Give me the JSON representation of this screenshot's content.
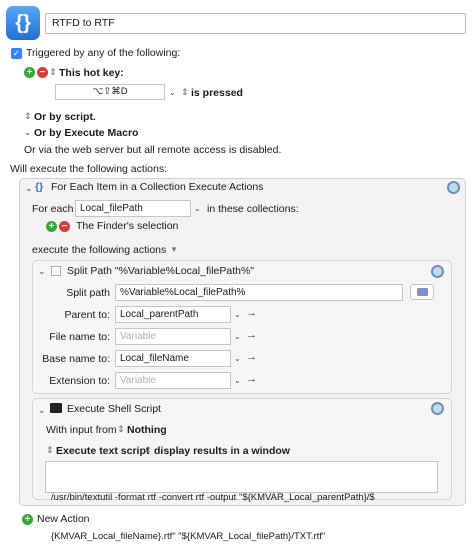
{
  "macro": {
    "icon_glyph": "{}",
    "name": "RTFD to RTF"
  },
  "trigger": {
    "checkbox_label": "Triggered by any of the following:",
    "hotkey_label": "This hot key:",
    "hotkey_value": "⌥⇧⌘D",
    "hotkey_state": "is pressed",
    "or_script": "Or by script.",
    "or_execute_macro": "Or by Execute Macro",
    "web_server_note": "Or via the web server but all remote access is disabled."
  },
  "actions_header": "Will execute the following actions:",
  "for_each": {
    "title": "For Each Item in a Collection Execute Actions",
    "for_each_label": "For each",
    "variable": "Local_filePath",
    "in_collections": "in these collections:",
    "collection_item": "The Finder's selection",
    "execute_label": "execute the following actions"
  },
  "split_path": {
    "title": "Split Path \"%Variable%Local_filePath%\"",
    "split_path_label": "Split path",
    "split_path_value": "%Variable%Local_filePath%",
    "parent_label": "Parent to:",
    "parent_value": "Local_parentPath",
    "file_name_label": "File name to:",
    "file_name_placeholder": "Variable",
    "base_name_label": "Base name to:",
    "base_name_value": "Local_fileName",
    "extension_label": "Extension to:",
    "extension_placeholder": "Variable"
  },
  "shell_script": {
    "title": "Execute Shell Script",
    "input_from_label": "With input from",
    "input_from_value": "Nothing",
    "execute_mode": "Execute text script",
    "display_mode": "display results in a window",
    "script_line1": "/usr/bin/textutil -format rtf -convert rtf -output \"${KMVAR_Local_parentPath}/$",
    "script_line2": "{KMVAR_Local_fileName}.rtf\" \"${KMVAR_Local_filePath}/TXT.rtf\""
  },
  "new_action": "New Action",
  "colors": {
    "accent": "#3b82f6",
    "plus": "#3aa53a",
    "minus": "#d93a3a"
  }
}
